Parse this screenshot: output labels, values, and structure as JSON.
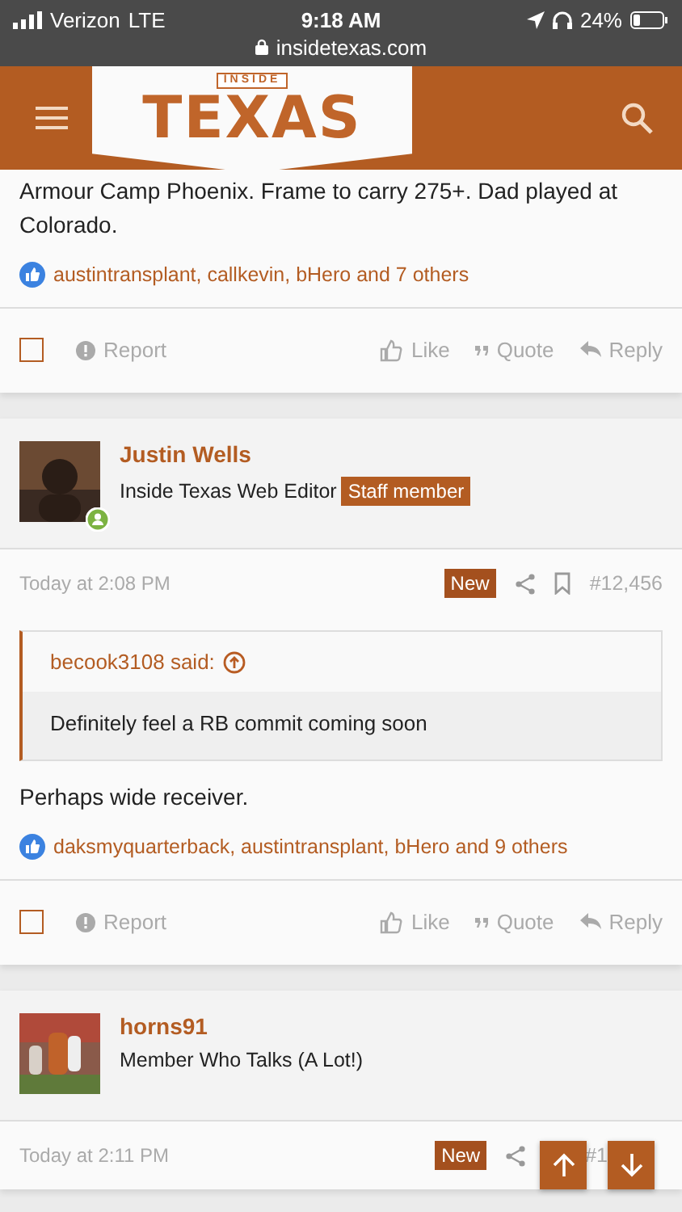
{
  "status_bar": {
    "carrier": "Verizon",
    "network": "LTE",
    "time": "9:18 AM",
    "battery": "24%",
    "url": "insidetexas.com"
  },
  "header": {
    "logo_word": "TEXAS",
    "logo_plate": "INSIDE"
  },
  "posts": [
    {
      "body": "Armour Camp Phoenix. Frame to carry 275+. Dad played at Colorado.",
      "likes": "austintransplant, callkevin, bHero and 7 others",
      "checked": false,
      "actions": [
        "Report",
        "Like",
        "Quote",
        "Reply"
      ]
    },
    {
      "author": "Justin Wells",
      "user_title": "Inside Texas Web Editor",
      "badge": "Staff member",
      "online": true,
      "time": "Today at 2:08 PM",
      "new_label": "New",
      "number": "#12,456",
      "quote": {
        "author": "becook3108 said:",
        "text": "Definitely feel a RB commit coming soon"
      },
      "body": "Perhaps wide receiver.",
      "likes": "daksmyquarterback, austintransplant, bHero and 9 others",
      "checked": false,
      "actions": [
        "Report",
        "Like",
        "Quote",
        "Reply"
      ]
    },
    {
      "author": "horns91",
      "user_title": "Member Who Talks (A Lot!)",
      "online": false,
      "time": "Today at 2:11 PM",
      "new_label": "New",
      "number": "#1"
    }
  ]
}
